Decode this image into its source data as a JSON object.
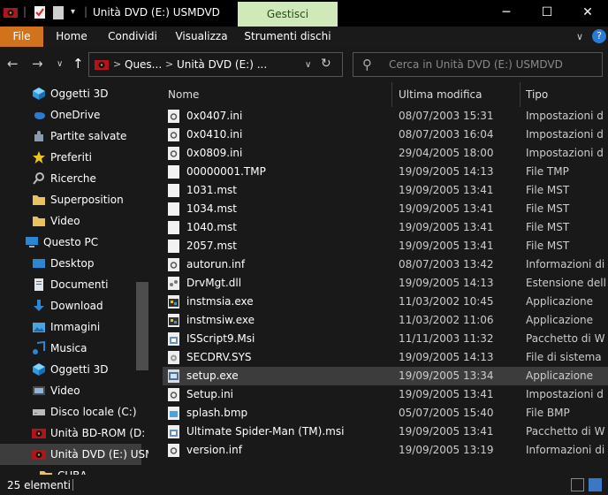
{
  "window": {
    "title": "Unità DVD (E:) USMDVD",
    "context_tab": "Gestisci",
    "minimize": "─",
    "maximize": "☐",
    "close": "✕"
  },
  "ribbon": {
    "tabs": [
      "File",
      "Home",
      "Condividi",
      "Visualizza",
      "Strumenti dischi"
    ],
    "collapse": "∨",
    "help": "?"
  },
  "address": {
    "back": "←",
    "forward": "→",
    "recent": "∨",
    "up": "↑",
    "crumb_sep": ">",
    "crumb1": "Ques...",
    "crumb2": "Unità DVD (E:) ...",
    "dropdown": "∨",
    "refresh": "↻",
    "search_placeholder": "Cerca in Unità DVD (E:) USMDVD",
    "search_icon": "⚲"
  },
  "nav": {
    "items": [
      {
        "label": "Oggetti 3D",
        "icon": "cube-3d-icon"
      },
      {
        "label": "OneDrive",
        "icon": "cloud-icon"
      },
      {
        "label": "Partite salvate",
        "icon": "puzzle-icon"
      },
      {
        "label": "Preferiti",
        "icon": "star-icon"
      },
      {
        "label": "Ricerche",
        "icon": "search-icon"
      },
      {
        "label": "Superposition",
        "icon": "folder-icon"
      },
      {
        "label": "Video",
        "icon": "folder-icon"
      },
      {
        "label": "Questo PC",
        "icon": "computer-icon"
      },
      {
        "label": "Desktop",
        "icon": "desktop-icon"
      },
      {
        "label": "Documenti",
        "icon": "documents-icon"
      },
      {
        "label": "Download",
        "icon": "download-icon"
      },
      {
        "label": "Immagini",
        "icon": "pictures-icon"
      },
      {
        "label": "Musica",
        "icon": "music-icon"
      },
      {
        "label": "Oggetti 3D",
        "icon": "cube-3d-icon"
      },
      {
        "label": "Video",
        "icon": "video-icon"
      },
      {
        "label": "Disco locale (C:)",
        "icon": "drive-icon"
      },
      {
        "label": "Unità BD-ROM (D:",
        "icon": "disc-drive-icon"
      },
      {
        "label": "Unità DVD (E:) USM",
        "icon": "disc-drive-icon"
      },
      {
        "label": "CUBA",
        "icon": "folder-icon"
      }
    ]
  },
  "columns": {
    "name": "Nome",
    "modified": "Ultima modifica",
    "type": "Tipo",
    "sort_arrow": "^"
  },
  "files": [
    {
      "name": "0x0407.ini",
      "date": "08/07/2003 15:31",
      "type": "Impostazioni d",
      "icon": "ini-file-icon"
    },
    {
      "name": "0x0410.ini",
      "date": "08/07/2003 16:04",
      "type": "Impostazioni d",
      "icon": "ini-file-icon"
    },
    {
      "name": "0x0809.ini",
      "date": "29/04/2005 18:00",
      "type": "Impostazioni d",
      "icon": "ini-file-icon"
    },
    {
      "name": "00000001.TMP",
      "date": "19/09/2005 14:13",
      "type": "File TMP",
      "icon": "file-icon"
    },
    {
      "name": "1031.mst",
      "date": "19/09/2005 13:41",
      "type": "File MST",
      "icon": "file-icon"
    },
    {
      "name": "1034.mst",
      "date": "19/09/2005 13:41",
      "type": "File MST",
      "icon": "file-icon"
    },
    {
      "name": "1040.mst",
      "date": "19/09/2005 13:41",
      "type": "File MST",
      "icon": "file-icon"
    },
    {
      "name": "2057.mst",
      "date": "19/09/2005 13:41",
      "type": "File MST",
      "icon": "file-icon"
    },
    {
      "name": "autorun.inf",
      "date": "08/07/2003 13:42",
      "type": "Informazioni di",
      "icon": "inf-file-icon"
    },
    {
      "name": "DrvMgt.dll",
      "date": "19/09/2005 14:13",
      "type": "Estensione dell",
      "icon": "dll-file-icon"
    },
    {
      "name": "instmsia.exe",
      "date": "11/03/2002 10:45",
      "type": "Applicazione",
      "icon": "installer-exe-icon"
    },
    {
      "name": "instmsiw.exe",
      "date": "11/03/2002 11:06",
      "type": "Applicazione",
      "icon": "installer-exe-icon"
    },
    {
      "name": "ISScript9.Msi",
      "date": "11/11/2003 11:32",
      "type": "Pacchetto di W",
      "icon": "msi-package-icon"
    },
    {
      "name": "SECDRV.SYS",
      "date": "19/09/2005 14:13",
      "type": "File di sistema",
      "icon": "sys-file-icon"
    },
    {
      "name": "setup.exe",
      "date": "19/09/2005 13:34",
      "type": "Applicazione",
      "icon": "setup-exe-icon"
    },
    {
      "name": "Setup.ini",
      "date": "19/09/2005 13:41",
      "type": "Impostazioni d",
      "icon": "ini-file-icon"
    },
    {
      "name": "splash.bmp",
      "date": "05/07/2005 15:40",
      "type": "File BMP",
      "icon": "bmp-file-icon"
    },
    {
      "name": "Ultimate Spider-Man (TM).msi",
      "date": "19/09/2005 13:41",
      "type": "Pacchetto di W",
      "icon": "msi-package-icon"
    },
    {
      "name": "version.inf",
      "date": "19/09/2005 13:19",
      "type": "Informazioni di",
      "icon": "inf-file-icon"
    }
  ],
  "selected_file_index": 14,
  "status": {
    "count": "25 elementi"
  },
  "colors": {
    "accent": "#d1731d",
    "context_tab": "#cfe9b8",
    "selection": "#3c3c3c"
  }
}
